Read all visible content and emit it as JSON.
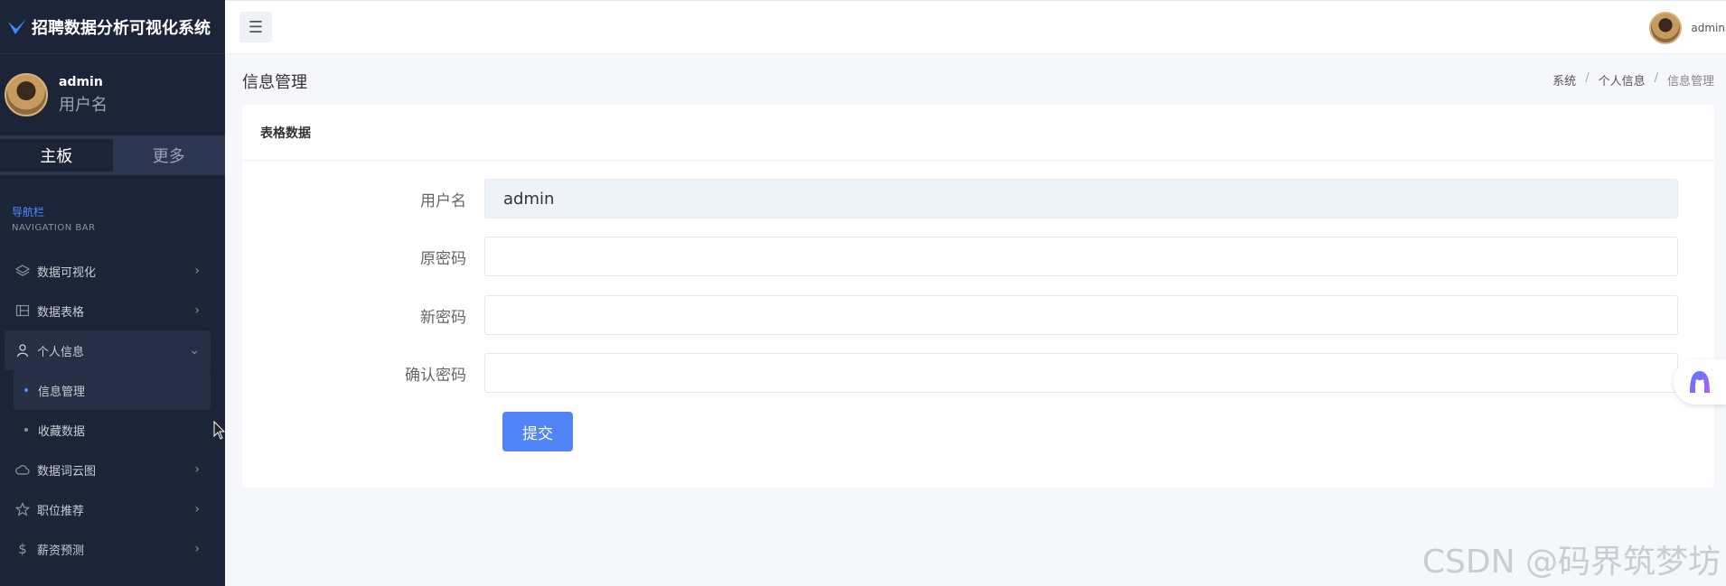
{
  "app": {
    "title": "招聘数据分析可视化系统"
  },
  "user": {
    "name": "admin",
    "role": "用户名"
  },
  "sidebar_tabs": [
    "主板",
    "更多"
  ],
  "nav": {
    "title": "导航栏",
    "subtitle": "NAVIGATION BAR"
  },
  "menu": [
    {
      "label": "数据可视化",
      "icon": "layers-icon"
    },
    {
      "label": "数据表格",
      "icon": "table-icon"
    },
    {
      "label": "个人信息",
      "icon": "user-icon",
      "open": true,
      "children": [
        {
          "label": "信息管理",
          "active": true
        },
        {
          "label": "收藏数据"
        }
      ]
    },
    {
      "label": "数据词云图",
      "icon": "cloud-icon"
    },
    {
      "label": "职位推荐",
      "icon": "star-icon"
    },
    {
      "label": "薪资预测",
      "icon": "dollar-icon"
    }
  ],
  "topbar": {
    "user": "admin"
  },
  "page": {
    "title": "信息管理",
    "breadcrumb": [
      "系统",
      "个人信息",
      "信息管理"
    ]
  },
  "card": {
    "title": "表格数据"
  },
  "form": {
    "username_label": "用户名",
    "username_value": "admin",
    "old_password_label": "原密码",
    "new_password_label": "新密码",
    "confirm_password_label": "确认密码",
    "submit_label": "提交"
  },
  "watermark": "CSDN @码界筑梦坊",
  "colors": {
    "sidebar_bg": "#1c2437",
    "accent": "#5184f6",
    "nav_title": "#4d8cff"
  }
}
